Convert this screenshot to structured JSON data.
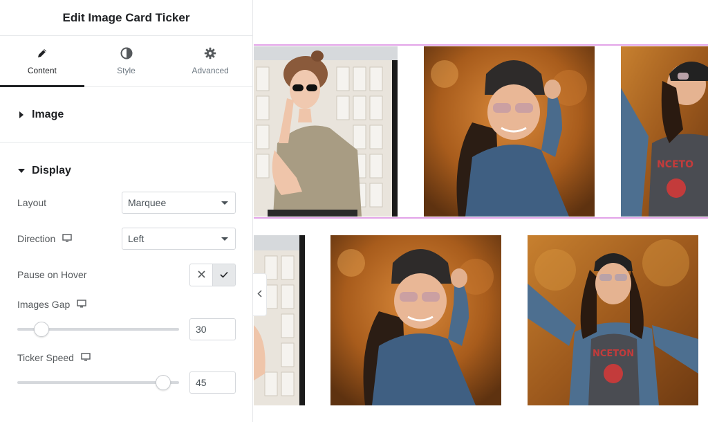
{
  "panel": {
    "title": "Edit Image Card Ticker",
    "tabs": [
      {
        "label": "Content",
        "icon": "pencil-icon",
        "active": true
      },
      {
        "label": "Style",
        "icon": "half-circle-icon",
        "active": false
      },
      {
        "label": "Advanced",
        "icon": "gear-icon",
        "active": false
      }
    ],
    "sections": {
      "image": {
        "title": "Image",
        "expanded": false
      },
      "display": {
        "title": "Display",
        "expanded": true
      }
    },
    "controls": {
      "layout": {
        "label": "Layout",
        "value": "Marquee"
      },
      "direction": {
        "label": "Direction",
        "value": "Left",
        "responsive_icon": "desktop-icon"
      },
      "pause_on_hover": {
        "label": "Pause on Hover",
        "off_icon": "close-icon",
        "on_icon": "check-icon",
        "selected": "on"
      },
      "images_gap": {
        "label": "Images Gap",
        "value": "30",
        "responsive_icon": "desktop-icon",
        "slider_fraction": 0.15
      },
      "ticker_speed": {
        "label": "Ticker Speed",
        "value": "45",
        "responsive_icon": "desktop-icon",
        "slider_fraction": 0.9
      }
    }
  },
  "colors": {
    "text_dark": "#1f2124",
    "text_muted": "#6d7882",
    "border": "#e6e8ea",
    "selection_outline": "#e2a3e8",
    "autumn_orange": "#b5661e"
  },
  "preview": {
    "collapse_icon": "chevron-left-icon",
    "row1": [
      "photo-girl-sunglasses-window",
      "photo-girl-beanie-denim",
      "photo-girl-princeton-shirt"
    ],
    "row2": [
      "photo-window-partial",
      "photo-girl-beanie-denim",
      "photo-girl-princeton-shirt"
    ]
  }
}
